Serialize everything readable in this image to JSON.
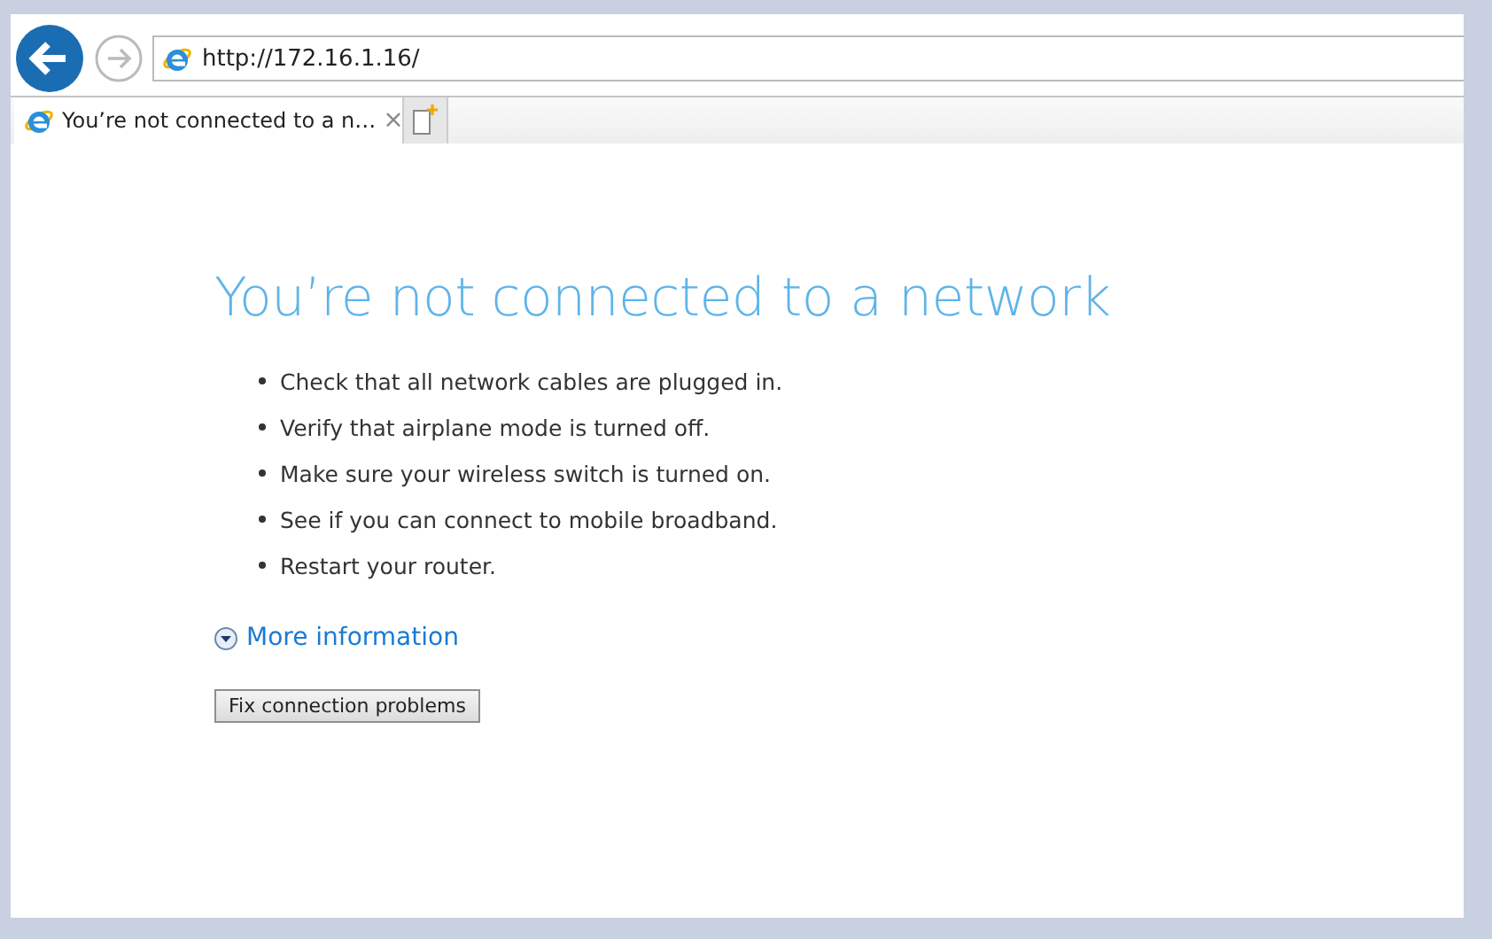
{
  "address_bar": {
    "url": "http://172.16.1.16/"
  },
  "tabs": [
    {
      "title": "You’re not connected to a n…",
      "close": "×",
      "selected": true
    }
  ],
  "page": {
    "heading": "You’re not connected to a network",
    "tips": [
      "Check that all network cables are plugged in.",
      "Verify that airplane mode is turned off.",
      "Make sure your wireless switch is turned on.",
      "See if you can connect to mobile broadband.",
      "Restart your router."
    ],
    "more_link": "More information",
    "expanded": false,
    "button": "Fix connection problems"
  }
}
